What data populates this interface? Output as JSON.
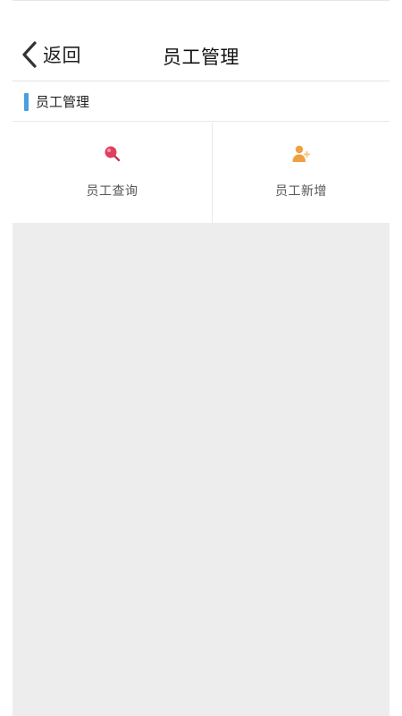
{
  "nav": {
    "back_label": "返回",
    "title": "员工管理"
  },
  "section": {
    "title": "员工管理",
    "accent_color": "#4a9fe0"
  },
  "menu": {
    "items": [
      {
        "label": "员工查询",
        "icon": "search-icon",
        "icon_color": "#e0405e"
      },
      {
        "label": "员工新增",
        "icon": "add-user-icon",
        "icon_color": "#f0a040"
      }
    ]
  }
}
